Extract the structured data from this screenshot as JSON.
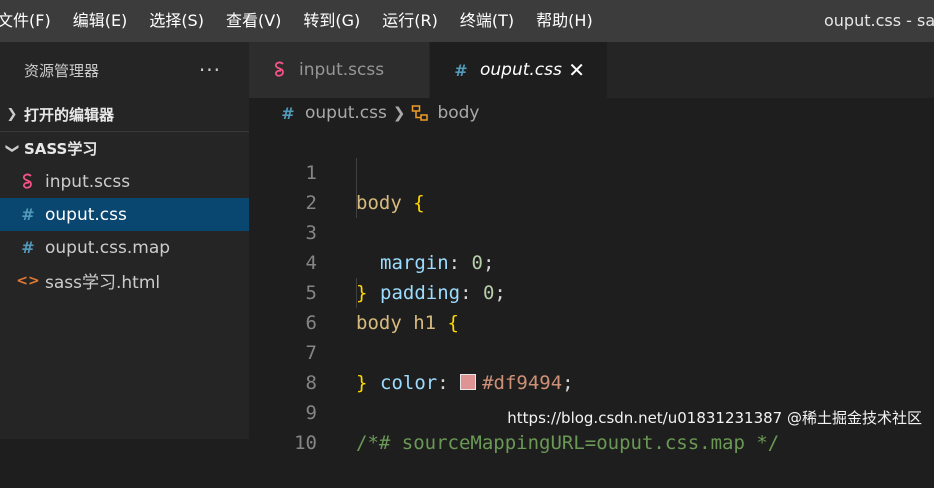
{
  "menubar": {
    "items": [
      "文件(F)",
      "编辑(E)",
      "选择(S)",
      "查看(V)",
      "转到(G)",
      "运行(R)",
      "终端(T)",
      "帮助(H)"
    ],
    "window_title": "ouput.css - sas"
  },
  "sidebar": {
    "title": "资源管理器",
    "more": "···",
    "open_editors": "打开的编辑器",
    "folder": "SASS学习",
    "files": [
      {
        "name": "input.scss",
        "icon": "sass-icon"
      },
      {
        "name": "ouput.css",
        "icon": "css-hash-icon",
        "selected": true
      },
      {
        "name": "ouput.css.map",
        "icon": "css-hash-icon"
      },
      {
        "name": "sass学习.html",
        "icon": "html-icon"
      }
    ]
  },
  "tabs": [
    {
      "label": "input.scss",
      "icon": "sass-icon",
      "active": false
    },
    {
      "label": "ouput.css",
      "icon": "css-hash-icon",
      "active": true,
      "close": "✕"
    }
  ],
  "breadcrumb": {
    "file": "ouput.css",
    "symbol": "body"
  },
  "editor": {
    "line_numbers": [
      "1",
      "2",
      "3",
      "4",
      "5",
      "6",
      "7",
      "8",
      "9",
      "10"
    ],
    "l1_sel": "body",
    "l1_brace": " {",
    "l2_prop": "margin",
    "l2_colon": ": ",
    "l2_val": "0",
    "l2_semi": ";",
    "l3_prop": "padding",
    "l3_colon": ": ",
    "l3_val": "0",
    "l3_semi": ";",
    "l4_brace": "}",
    "l5_sel": "body h1",
    "l5_brace": " {",
    "l6_prop": "color",
    "l6_colon": ": ",
    "l6_val": "#df9494",
    "l6_semi": ";",
    "l7_brace": "}",
    "l9_comment": "/*# sourceMappingURL=ouput.css.map */",
    "swatch_color": "#df9494"
  },
  "watermark": "https://blog.csdn.net/u01831231387 @稀土掘金技术社区",
  "colors": {
    "accent_selection": "#094771",
    "css_hash": "#519aba",
    "sass": "#f55385",
    "html": "#e37933"
  }
}
